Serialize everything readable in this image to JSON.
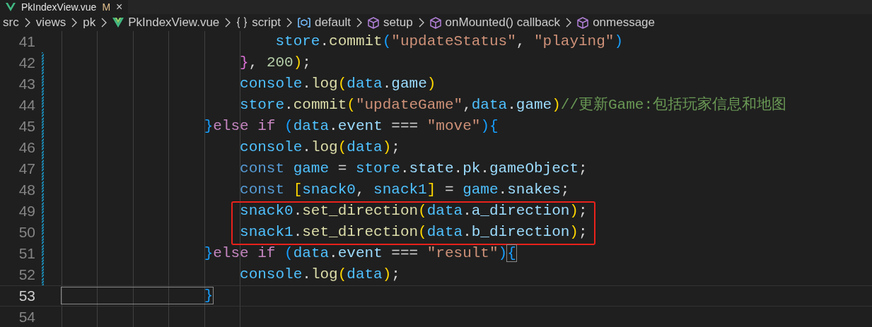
{
  "tab": {
    "label": "PkIndexView.vue",
    "badge": "M",
    "close": "×",
    "selected": true
  },
  "breadcrumbs": [
    {
      "label": "src",
      "kind": "folder"
    },
    {
      "label": "views",
      "kind": "folder"
    },
    {
      "label": "pk",
      "kind": "folder"
    },
    {
      "label": "PkIndexView.vue",
      "kind": "vue"
    },
    {
      "label": "script",
      "kind": "braces"
    },
    {
      "label": "default",
      "kind": "module"
    },
    {
      "label": "setup",
      "kind": "method"
    },
    {
      "label": "onMounted() callback",
      "kind": "method"
    },
    {
      "label": "onmessage",
      "kind": "method"
    }
  ],
  "lines": [
    {
      "number": "41",
      "modified": false,
      "current": false,
      "boxed": false,
      "tokens": [
        {
          "text": "                        store",
          "kind": "const"
        },
        {
          "text": ".",
          "kind": "plain"
        },
        {
          "text": "commit",
          "kind": "func"
        },
        {
          "text": "(",
          "kind": "b3"
        },
        {
          "text": "\"updateStatus\"",
          "kind": "string"
        },
        {
          "text": ", ",
          "kind": "plain"
        },
        {
          "text": "\"playing\"",
          "kind": "string"
        },
        {
          "text": ")",
          "kind": "b3"
        }
      ]
    },
    {
      "number": "42",
      "modified": true,
      "current": false,
      "boxed": false,
      "tokens": [
        {
          "text": "                    }",
          "kind": "b2"
        },
        {
          "text": ", ",
          "kind": "plain"
        },
        {
          "text": "200",
          "kind": "number"
        },
        {
          "text": ")",
          "kind": "b1"
        },
        {
          "text": ";",
          "kind": "plain"
        }
      ]
    },
    {
      "number": "43",
      "modified": true,
      "current": false,
      "boxed": false,
      "tokens": [
        {
          "text": "                    console",
          "kind": "const"
        },
        {
          "text": ".",
          "kind": "plain"
        },
        {
          "text": "log",
          "kind": "func"
        },
        {
          "text": "(",
          "kind": "b1"
        },
        {
          "text": "data",
          "kind": "const"
        },
        {
          "text": ".",
          "kind": "plain"
        },
        {
          "text": "game",
          "kind": "var"
        },
        {
          "text": ")",
          "kind": "b1"
        }
      ]
    },
    {
      "number": "44",
      "modified": true,
      "current": false,
      "boxed": false,
      "tokens": [
        {
          "text": "                    store",
          "kind": "const"
        },
        {
          "text": ".",
          "kind": "plain"
        },
        {
          "text": "commit",
          "kind": "func"
        },
        {
          "text": "(",
          "kind": "b1"
        },
        {
          "text": "\"updateGame\"",
          "kind": "string"
        },
        {
          "text": ",",
          "kind": "plain"
        },
        {
          "text": "data",
          "kind": "const"
        },
        {
          "text": ".",
          "kind": "plain"
        },
        {
          "text": "game",
          "kind": "var"
        },
        {
          "text": ")",
          "kind": "b1"
        },
        {
          "text": "//更新Game:包括玩家信息和地图",
          "kind": "comment"
        }
      ]
    },
    {
      "number": "45",
      "modified": true,
      "current": false,
      "boxed": false,
      "tokens": [
        {
          "text": "                }",
          "kind": "b3"
        },
        {
          "text": "else if ",
          "kind": "control"
        },
        {
          "text": "(",
          "kind": "b3"
        },
        {
          "text": "data",
          "kind": "const"
        },
        {
          "text": ".",
          "kind": "plain"
        },
        {
          "text": "event",
          "kind": "var"
        },
        {
          "text": " === ",
          "kind": "plain"
        },
        {
          "text": "\"move\"",
          "kind": "string"
        },
        {
          "text": ")",
          "kind": "b3"
        },
        {
          "text": "{",
          "kind": "b3"
        }
      ]
    },
    {
      "number": "46",
      "modified": true,
      "current": false,
      "boxed": false,
      "tokens": [
        {
          "text": "                    console",
          "kind": "const"
        },
        {
          "text": ".",
          "kind": "plain"
        },
        {
          "text": "log",
          "kind": "func"
        },
        {
          "text": "(",
          "kind": "b1"
        },
        {
          "text": "data",
          "kind": "const"
        },
        {
          "text": ")",
          "kind": "b1"
        },
        {
          "text": ";",
          "kind": "plain"
        }
      ]
    },
    {
      "number": "47",
      "modified": true,
      "current": false,
      "boxed": false,
      "tokens": [
        {
          "text": "                    const ",
          "kind": "keyword"
        },
        {
          "text": "game",
          "kind": "const"
        },
        {
          "text": " = ",
          "kind": "plain"
        },
        {
          "text": "store",
          "kind": "const"
        },
        {
          "text": ".",
          "kind": "plain"
        },
        {
          "text": "state",
          "kind": "var"
        },
        {
          "text": ".",
          "kind": "plain"
        },
        {
          "text": "pk",
          "kind": "var"
        },
        {
          "text": ".",
          "kind": "plain"
        },
        {
          "text": "gameObject",
          "kind": "var"
        },
        {
          "text": ";",
          "kind": "plain"
        }
      ]
    },
    {
      "number": "48",
      "modified": true,
      "current": false,
      "boxed": false,
      "tokens": [
        {
          "text": "                    const ",
          "kind": "keyword"
        },
        {
          "text": "[",
          "kind": "b1"
        },
        {
          "text": "snack0",
          "kind": "const"
        },
        {
          "text": ", ",
          "kind": "plain"
        },
        {
          "text": "snack1",
          "kind": "const"
        },
        {
          "text": "]",
          "kind": "b1"
        },
        {
          "text": " = ",
          "kind": "plain"
        },
        {
          "text": "game",
          "kind": "const"
        },
        {
          "text": ".",
          "kind": "plain"
        },
        {
          "text": "snakes",
          "kind": "var"
        },
        {
          "text": ";",
          "kind": "plain"
        }
      ]
    },
    {
      "number": "49",
      "modified": true,
      "current": false,
      "boxed": true,
      "tokens": [
        {
          "text": "                    snack0",
          "kind": "const"
        },
        {
          "text": ".",
          "kind": "plain"
        },
        {
          "text": "set_direction",
          "kind": "func"
        },
        {
          "text": "(",
          "kind": "b1"
        },
        {
          "text": "data",
          "kind": "const"
        },
        {
          "text": ".",
          "kind": "plain"
        },
        {
          "text": "a_direction",
          "kind": "var"
        },
        {
          "text": ")",
          "kind": "b1"
        },
        {
          "text": ";",
          "kind": "plain"
        }
      ]
    },
    {
      "number": "50",
      "modified": true,
      "current": false,
      "boxed": true,
      "tokens": [
        {
          "text": "                    snack1",
          "kind": "const"
        },
        {
          "text": ".",
          "kind": "plain"
        },
        {
          "text": "set_direction",
          "kind": "func"
        },
        {
          "text": "(",
          "kind": "b1"
        },
        {
          "text": "data",
          "kind": "const"
        },
        {
          "text": ".",
          "kind": "plain"
        },
        {
          "text": "b_direction",
          "kind": "var"
        },
        {
          "text": ")",
          "kind": "b1"
        },
        {
          "text": ";",
          "kind": "plain"
        }
      ]
    },
    {
      "number": "51",
      "modified": true,
      "current": false,
      "boxed": false,
      "tokens": [
        {
          "text": "                }",
          "kind": "b3"
        },
        {
          "text": "else if ",
          "kind": "control"
        },
        {
          "text": "(",
          "kind": "b3"
        },
        {
          "text": "data",
          "kind": "const"
        },
        {
          "text": ".",
          "kind": "plain"
        },
        {
          "text": "event",
          "kind": "var"
        },
        {
          "text": " === ",
          "kind": "plain"
        },
        {
          "text": "\"result\"",
          "kind": "string"
        },
        {
          "text": ")",
          "kind": "b3"
        },
        {
          "text": "{",
          "kind": "match"
        }
      ]
    },
    {
      "number": "52",
      "modified": true,
      "current": false,
      "boxed": false,
      "tokens": [
        {
          "text": "                    console",
          "kind": "const"
        },
        {
          "text": ".",
          "kind": "plain"
        },
        {
          "text": "log",
          "kind": "func"
        },
        {
          "text": "(",
          "kind": "b1"
        },
        {
          "text": "data",
          "kind": "const"
        },
        {
          "text": ")",
          "kind": "b1"
        },
        {
          "text": ";",
          "kind": "plain"
        }
      ]
    },
    {
      "number": "53",
      "modified": false,
      "current": true,
      "boxed": false,
      "tokens": [
        {
          "text": "                }",
          "kind": "match"
        }
      ]
    },
    {
      "number": "54",
      "modified": false,
      "current": false,
      "boxed": false
    }
  ]
}
